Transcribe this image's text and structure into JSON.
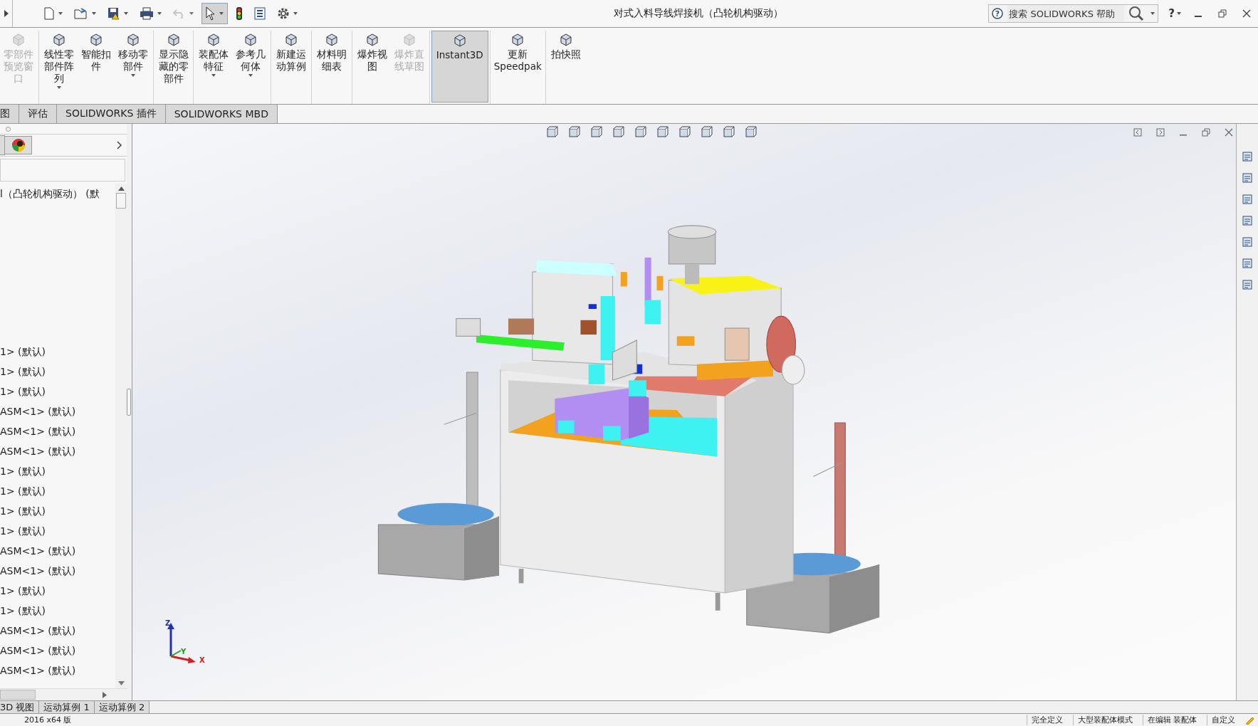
{
  "window": {
    "title": "对式入料导线焊接机（凸轮机构驱动）"
  },
  "quick_access": [
    {
      "kind": "new",
      "disabled": false,
      "selected": false,
      "caret": true
    },
    {
      "kind": "open",
      "disabled": false,
      "selected": false,
      "caret": true
    },
    {
      "kind": "save",
      "disabled": false,
      "selected": false,
      "caret": true
    },
    {
      "kind": "print",
      "disabled": false,
      "selected": false,
      "caret": true
    },
    {
      "kind": "undo",
      "disabled": true,
      "selected": false,
      "caret": true
    },
    {
      "kind": "select",
      "disabled": false,
      "selected": true,
      "caret": true
    },
    {
      "kind": "rebuild",
      "disabled": false,
      "selected": false,
      "caret": false
    },
    {
      "kind": "file-props",
      "disabled": false,
      "selected": false,
      "caret": false
    },
    {
      "kind": "options",
      "disabled": false,
      "selected": false,
      "caret": true
    }
  ],
  "search": {
    "placeholder": "搜索 SOLIDWORKS 帮助",
    "help_mark": "?"
  },
  "help": "?",
  "ribbon": [
    {
      "label": "零部件预览窗口",
      "disabled": true,
      "selected": false,
      "caret": false
    },
    {
      "label": "线性零部件阵列",
      "disabled": false,
      "selected": false,
      "caret": true
    },
    {
      "label": "智能扣件",
      "disabled": false,
      "selected": false,
      "caret": false
    },
    {
      "label": "移动零部件",
      "disabled": false,
      "selected": false,
      "caret": true
    },
    {
      "label": "显示隐藏的零部件",
      "disabled": false,
      "selected": false,
      "caret": false
    },
    {
      "label": "装配体特征",
      "disabled": false,
      "selected": false,
      "caret": true
    },
    {
      "label": "参考几何体",
      "disabled": false,
      "selected": false,
      "caret": true
    },
    {
      "label": "新建运动算例",
      "disabled": false,
      "selected": false,
      "caret": false
    },
    {
      "label": "材料明细表",
      "disabled": false,
      "selected": false,
      "caret": false
    },
    {
      "label": "爆炸视图",
      "disabled": false,
      "selected": false,
      "caret": false
    },
    {
      "label": "爆炸直线草图",
      "disabled": true,
      "selected": false,
      "caret": false
    },
    {
      "label": "Instant3D",
      "disabled": false,
      "selected": true,
      "caret": false
    },
    {
      "label": "更新 Speedpak",
      "disabled": false,
      "selected": false,
      "caret": false
    },
    {
      "label": "拍快照",
      "disabled": false,
      "selected": false,
      "caret": false
    }
  ],
  "tabs": [
    {
      "label": "图",
      "selected": false
    },
    {
      "label": "评估",
      "selected": false
    },
    {
      "label": "SOLIDWORKS 插件",
      "selected": false
    },
    {
      "label": "SOLIDWORKS MBD",
      "selected": false
    }
  ],
  "tree": {
    "root": "l（凸轮机构驱动） (默",
    "items": [
      "1> (默认)",
      "1> (默认)",
      "1> (默认)",
      "ASM<1> (默认)",
      "ASM<1> (默认)",
      "ASM<1> (默认)",
      "1> (默认)",
      "1> (默认)",
      "1> (默认)",
      "1> (默认)",
      "ASM<1> (默认)",
      "ASM<1> (默认)",
      "1> (默认)",
      "1> (默认)",
      "ASM<1> (默认)",
      "ASM<1> (默认)",
      "ASM<1> (默认)"
    ]
  },
  "triad": {
    "z": "Z",
    "y": "Y",
    "x": "X"
  },
  "bottom_tabs": [
    {
      "label": "3D 视图",
      "selected": false
    },
    {
      "label": "运动算例 1",
      "selected": false
    },
    {
      "label": "运动算例 2",
      "selected": false
    }
  ],
  "status_bar": {
    "version": "2016 x64 版",
    "items": [
      "完全定义",
      "大型装配体模式",
      "在编辑 装配体",
      "自定义"
    ]
  }
}
